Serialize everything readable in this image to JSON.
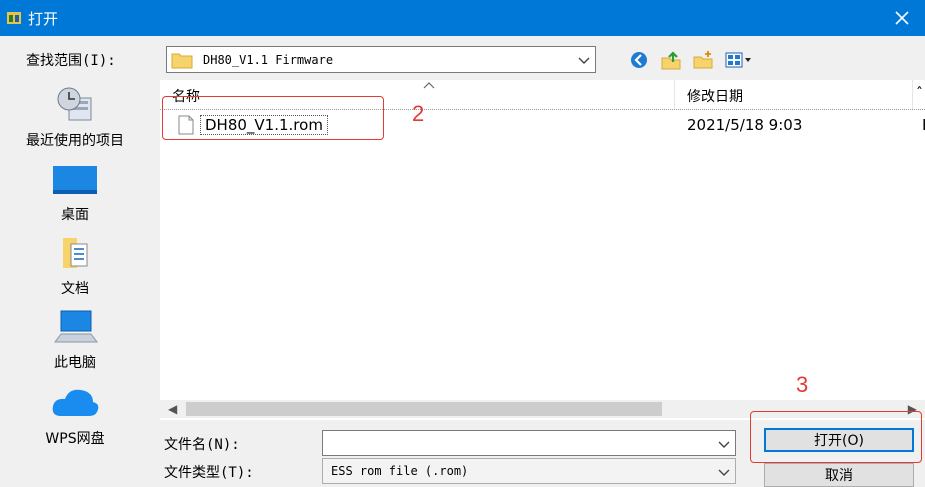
{
  "window": {
    "title": "打开"
  },
  "lookin": {
    "label": "查找范围(I):",
    "value": "DH80_V1.1 Firmware"
  },
  "places": [
    {
      "label": "最近使用的项目",
      "icon": "recent-items-icon"
    },
    {
      "label": "桌面",
      "icon": "desktop-icon"
    },
    {
      "label": "文档",
      "icon": "documents-icon"
    },
    {
      "label": "此电脑",
      "icon": "this-pc-icon"
    },
    {
      "label": "WPS网盘",
      "icon": "wps-cloud-icon"
    }
  ],
  "columns": {
    "name": "名称",
    "modified": "修改日期",
    "next_trunc": "ˆ"
  },
  "files": [
    {
      "name": "DH80_V1.1.rom",
      "modified": "2021/5/18 9:03",
      "trunc": "F"
    }
  ],
  "filename": {
    "label": "文件名(N):",
    "value": ""
  },
  "filetype": {
    "label": "文件类型(T):",
    "value": "ESS rom file (.rom)"
  },
  "buttons": {
    "open": "打开(O)",
    "cancel": "取消"
  },
  "annotations": {
    "step2": "2",
    "step3": "3"
  },
  "colors": {
    "titlebar": "#0078d7",
    "annotation": "#e53935"
  }
}
